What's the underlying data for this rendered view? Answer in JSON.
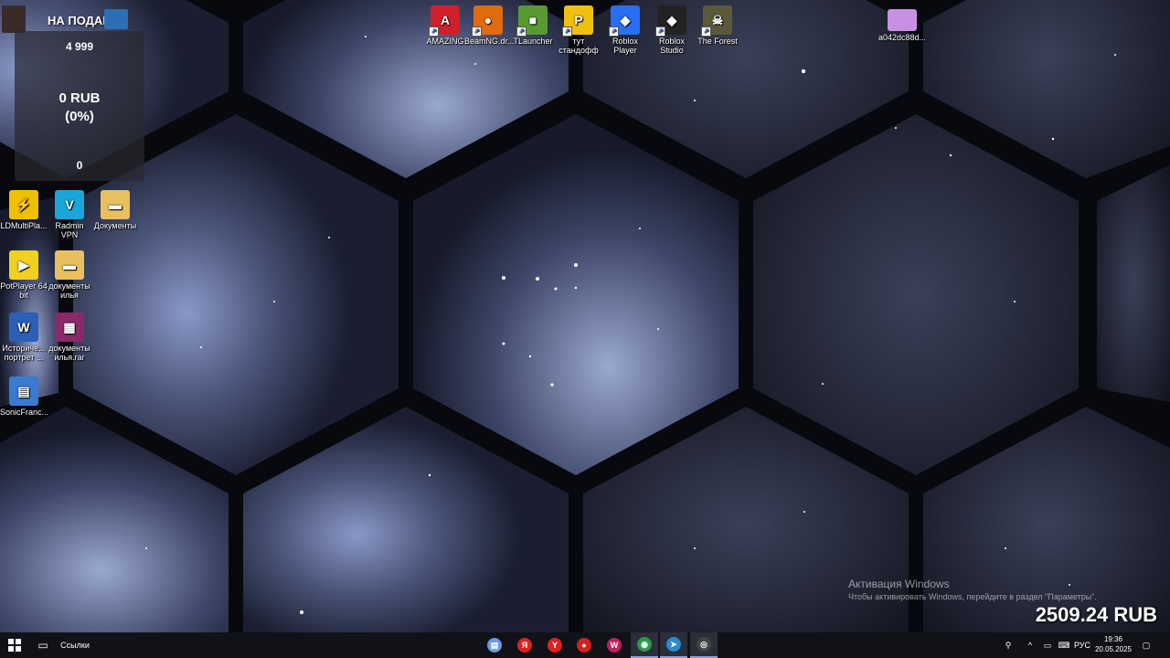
{
  "donation_widget": {
    "banner_label": "НА ПОДАРОК",
    "goal": "4 999",
    "raised": "0 RUB",
    "percent": "(0%)",
    "count": "0"
  },
  "desktop_icons_top": [
    {
      "label": "AMAZING",
      "icon": "amazing-icon",
      "color": "#d0202a",
      "glyph": "A"
    },
    {
      "label": "BeamNG.dr...",
      "icon": "beamng-icon",
      "color": "#e06a10",
      "glyph": "●"
    },
    {
      "label": "TLauncher",
      "icon": "tlauncher-icon",
      "color": "#5a9a32",
      "glyph": "■"
    },
    {
      "label": "тут стандофф",
      "icon": "standoff-icon",
      "color": "#f0c010",
      "glyph": "P"
    },
    {
      "label": "Roblox Player",
      "icon": "roblox-player-icon",
      "color": "#2a6ef2",
      "glyph": "◆"
    },
    {
      "label": "Roblox Studio",
      "icon": "roblox-studio-icon",
      "color": "#222222",
      "glyph": "◆"
    },
    {
      "label": "The Forest",
      "icon": "the-forest-icon",
      "color": "#5a5a3a",
      "glyph": "☠"
    }
  ],
  "desktop_icon_image": {
    "label": "a042dc88d...",
    "icon": "image-file-icon",
    "color": "#c890e0"
  },
  "desktop_icons_left": [
    {
      "label": "LDMultiPla...",
      "icon": "ldmultiplayer-icon",
      "color": "#f0c000",
      "glyph": "⚡"
    },
    {
      "label": "Radmin VPN",
      "icon": "radmin-vpn-icon",
      "color": "#1aa6d8",
      "glyph": "V"
    },
    {
      "label": "Документы",
      "icon": "folder-documents-icon",
      "color": "#e8c060",
      "glyph": "▬"
    },
    {
      "label": "PotPlayer 64 bit",
      "icon": "potplayer-icon",
      "color": "#f0d020",
      "glyph": "▶"
    },
    {
      "label": "документы илья",
      "icon": "folder-ilya-icon",
      "color": "#e8c060",
      "glyph": "▬"
    },
    {
      "label": "Историче... портрет ...",
      "icon": "word-document-icon",
      "color": "#2b5fb8",
      "glyph": "W"
    },
    {
      "label": "документы илья.rar",
      "icon": "winrar-archive-icon",
      "color": "#8a2a6a",
      "glyph": "▦"
    },
    {
      "label": "SonicFranc...",
      "icon": "sonic-file-icon",
      "color": "#3a7ad0",
      "glyph": "▤"
    }
  ],
  "watermark": {
    "title": "Активация Windows",
    "subtitle": "Чтобы активировать Windows, перейдите в раздел \"Параметры\"."
  },
  "overlay_balance": "2509.24 RUB",
  "taskbar": {
    "search_label": "Ссылки",
    "language": "РУС",
    "time": "19:36",
    "date": "20.05.2025",
    "apps": [
      {
        "name": "notepad",
        "color": "#6a9ae0",
        "glyph": "▤"
      },
      {
        "name": "yandex",
        "color": "#e02020",
        "glyph": "Я"
      },
      {
        "name": "yandex-browser",
        "color": "#e02020",
        "glyph": "Y"
      },
      {
        "name": "recorder",
        "color": "#d02020",
        "glyph": "●"
      },
      {
        "name": "wildberries",
        "color": "#c02060",
        "glyph": "W"
      },
      {
        "name": "chrome",
        "color": "#2a9a4a",
        "glyph": "◉"
      },
      {
        "name": "telegram",
        "color": "#2a8ad0",
        "glyph": "➤"
      },
      {
        "name": "obs",
        "color": "#444444",
        "glyph": "◎"
      }
    ]
  }
}
